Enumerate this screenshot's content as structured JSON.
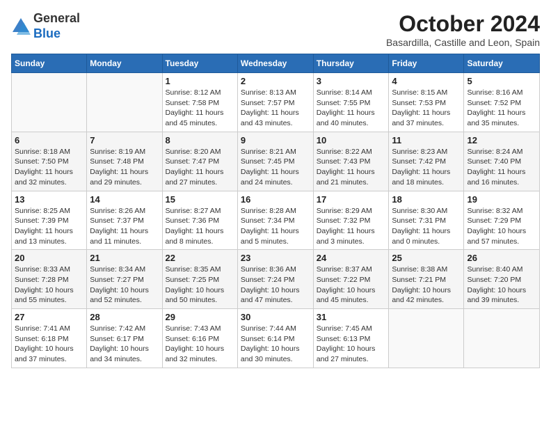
{
  "header": {
    "logo_general": "General",
    "logo_blue": "Blue",
    "month": "October 2024",
    "location": "Basardilla, Castille and Leon, Spain"
  },
  "weekdays": [
    "Sunday",
    "Monday",
    "Tuesday",
    "Wednesday",
    "Thursday",
    "Friday",
    "Saturday"
  ],
  "weeks": [
    [
      {
        "day": "",
        "info": ""
      },
      {
        "day": "",
        "info": ""
      },
      {
        "day": "1",
        "info": "Sunrise: 8:12 AM\nSunset: 7:58 PM\nDaylight: 11 hours and 45 minutes."
      },
      {
        "day": "2",
        "info": "Sunrise: 8:13 AM\nSunset: 7:57 PM\nDaylight: 11 hours and 43 minutes."
      },
      {
        "day": "3",
        "info": "Sunrise: 8:14 AM\nSunset: 7:55 PM\nDaylight: 11 hours and 40 minutes."
      },
      {
        "day": "4",
        "info": "Sunrise: 8:15 AM\nSunset: 7:53 PM\nDaylight: 11 hours and 37 minutes."
      },
      {
        "day": "5",
        "info": "Sunrise: 8:16 AM\nSunset: 7:52 PM\nDaylight: 11 hours and 35 minutes."
      }
    ],
    [
      {
        "day": "6",
        "info": "Sunrise: 8:18 AM\nSunset: 7:50 PM\nDaylight: 11 hours and 32 minutes."
      },
      {
        "day": "7",
        "info": "Sunrise: 8:19 AM\nSunset: 7:48 PM\nDaylight: 11 hours and 29 minutes."
      },
      {
        "day": "8",
        "info": "Sunrise: 8:20 AM\nSunset: 7:47 PM\nDaylight: 11 hours and 27 minutes."
      },
      {
        "day": "9",
        "info": "Sunrise: 8:21 AM\nSunset: 7:45 PM\nDaylight: 11 hours and 24 minutes."
      },
      {
        "day": "10",
        "info": "Sunrise: 8:22 AM\nSunset: 7:43 PM\nDaylight: 11 hours and 21 minutes."
      },
      {
        "day": "11",
        "info": "Sunrise: 8:23 AM\nSunset: 7:42 PM\nDaylight: 11 hours and 18 minutes."
      },
      {
        "day": "12",
        "info": "Sunrise: 8:24 AM\nSunset: 7:40 PM\nDaylight: 11 hours and 16 minutes."
      }
    ],
    [
      {
        "day": "13",
        "info": "Sunrise: 8:25 AM\nSunset: 7:39 PM\nDaylight: 11 hours and 13 minutes."
      },
      {
        "day": "14",
        "info": "Sunrise: 8:26 AM\nSunset: 7:37 PM\nDaylight: 11 hours and 11 minutes."
      },
      {
        "day": "15",
        "info": "Sunrise: 8:27 AM\nSunset: 7:36 PM\nDaylight: 11 hours and 8 minutes."
      },
      {
        "day": "16",
        "info": "Sunrise: 8:28 AM\nSunset: 7:34 PM\nDaylight: 11 hours and 5 minutes."
      },
      {
        "day": "17",
        "info": "Sunrise: 8:29 AM\nSunset: 7:32 PM\nDaylight: 11 hours and 3 minutes."
      },
      {
        "day": "18",
        "info": "Sunrise: 8:30 AM\nSunset: 7:31 PM\nDaylight: 11 hours and 0 minutes."
      },
      {
        "day": "19",
        "info": "Sunrise: 8:32 AM\nSunset: 7:29 PM\nDaylight: 10 hours and 57 minutes."
      }
    ],
    [
      {
        "day": "20",
        "info": "Sunrise: 8:33 AM\nSunset: 7:28 PM\nDaylight: 10 hours and 55 minutes."
      },
      {
        "day": "21",
        "info": "Sunrise: 8:34 AM\nSunset: 7:27 PM\nDaylight: 10 hours and 52 minutes."
      },
      {
        "day": "22",
        "info": "Sunrise: 8:35 AM\nSunset: 7:25 PM\nDaylight: 10 hours and 50 minutes."
      },
      {
        "day": "23",
        "info": "Sunrise: 8:36 AM\nSunset: 7:24 PM\nDaylight: 10 hours and 47 minutes."
      },
      {
        "day": "24",
        "info": "Sunrise: 8:37 AM\nSunset: 7:22 PM\nDaylight: 10 hours and 45 minutes."
      },
      {
        "day": "25",
        "info": "Sunrise: 8:38 AM\nSunset: 7:21 PM\nDaylight: 10 hours and 42 minutes."
      },
      {
        "day": "26",
        "info": "Sunrise: 8:40 AM\nSunset: 7:20 PM\nDaylight: 10 hours and 39 minutes."
      }
    ],
    [
      {
        "day": "27",
        "info": "Sunrise: 7:41 AM\nSunset: 6:18 PM\nDaylight: 10 hours and 37 minutes."
      },
      {
        "day": "28",
        "info": "Sunrise: 7:42 AM\nSunset: 6:17 PM\nDaylight: 10 hours and 34 minutes."
      },
      {
        "day": "29",
        "info": "Sunrise: 7:43 AM\nSunset: 6:16 PM\nDaylight: 10 hours and 32 minutes."
      },
      {
        "day": "30",
        "info": "Sunrise: 7:44 AM\nSunset: 6:14 PM\nDaylight: 10 hours and 30 minutes."
      },
      {
        "day": "31",
        "info": "Sunrise: 7:45 AM\nSunset: 6:13 PM\nDaylight: 10 hours and 27 minutes."
      },
      {
        "day": "",
        "info": ""
      },
      {
        "day": "",
        "info": ""
      }
    ]
  ]
}
